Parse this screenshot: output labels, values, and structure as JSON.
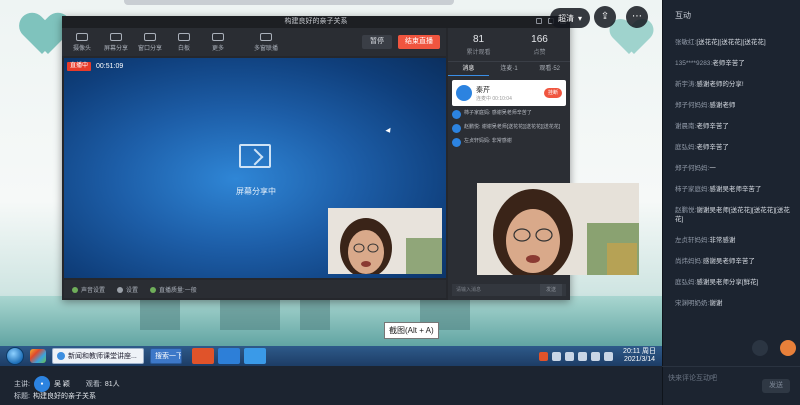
{
  "stream": {
    "window_title": "构建良好的亲子关系",
    "tools": [
      "摄像头",
      "屏幕分享",
      "窗口分享",
      "白板",
      "更多",
      "多窗联播"
    ],
    "pause_label": "暂停",
    "end_label": "结束直播",
    "live_tag": "直播中",
    "live_time": "00:51:09",
    "share_text": "屏幕分享中",
    "bottom_items": [
      "声音设置",
      "设置",
      "直播质量:一般"
    ],
    "stats": [
      {
        "value": "81",
        "label": "累计观看"
      },
      {
        "value": "166",
        "label": "点赞"
      }
    ],
    "tabs": [
      "消息",
      "连麦·1",
      "观看·52"
    ],
    "student": {
      "name": "秦芹",
      "sub": "连麦中 00:10:04",
      "button": "挂断"
    },
    "messages": [
      "柿子家庭妈: 感谢吴老师辛苦了",
      "赵鹏悦: 谢谢吴老师[送花花][送花花][送花花]",
      "左贞轩妈妈: 非常感谢"
    ],
    "input_placeholder": "请输入消息",
    "send_label": "发送",
    "tooltip": "截图(Alt + A)",
    "taskbar_window": "新闻和教师课堂讲座...",
    "taskbar_window2": "搜索一下",
    "clock_time": "20:11 周日",
    "clock_date": "2021/3/14"
  },
  "top_controls": {
    "quality_label": "超清"
  },
  "sidebar": {
    "title": "互动",
    "chat": [
      {
        "user": "张敏红:",
        "text": "[送花花][送花花][送花花]"
      },
      {
        "user": "135****9283:",
        "text": "老师辛苦了"
      },
      {
        "user": "新宇涛:",
        "text": "感谢老师的分享!"
      },
      {
        "user": "郑子何妈妈:",
        "text": "感谢老师"
      },
      {
        "user": "谢晨南:",
        "text": "老师辛苦了"
      },
      {
        "user": "庭弘妈:",
        "text": "老师辛苦了"
      },
      {
        "user": "郑子何妈妈:",
        "text": "一"
      },
      {
        "user": "柿子家庭妈:",
        "text": "感谢吴老师辛苦了"
      },
      {
        "user": "赵鹏悦:",
        "text": "谢谢吴老师[送花花][送花花][送花花]"
      },
      {
        "user": "左贞轩妈妈:",
        "text": "非常感谢"
      },
      {
        "user": "尚炜妈妈:",
        "text": "感谢吴老师辛苦了"
      },
      {
        "user": "庭弘妈:",
        "text": "感谢吴老师分享[鲜花]"
      },
      {
        "user": "宋渊明奶奶:",
        "text": "谢谢"
      }
    ],
    "input_placeholder": "快来评论互动吧",
    "send_label": "发送"
  },
  "info": {
    "host_label": "主讲:",
    "host_name": "吴 颖",
    "viewers_label": "观看:",
    "viewers_value": "81人",
    "topic_label": "标题:",
    "topic_value": "构建良好的亲子关系"
  }
}
